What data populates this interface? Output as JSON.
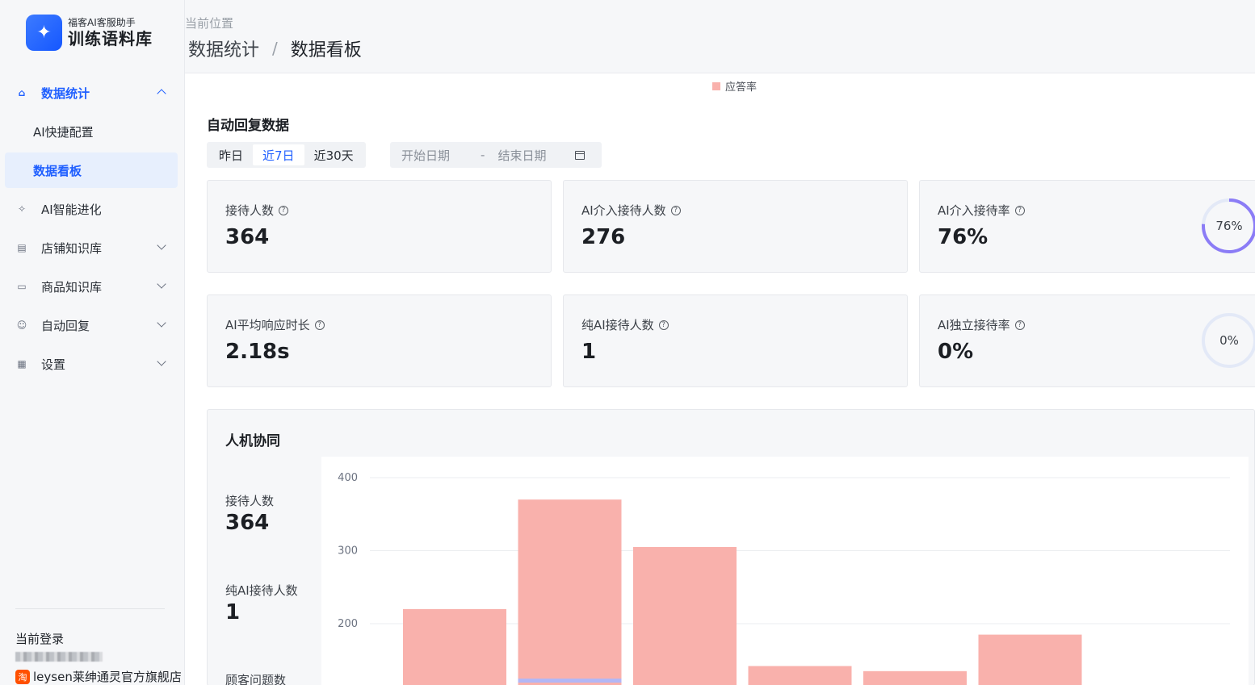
{
  "brand": {
    "subtitle": "福客AI客服助手",
    "title": "训练语料库",
    "logo_icon": "sparkle-icon"
  },
  "sidebar": {
    "items": [
      {
        "label": "数据统计",
        "icon": "home-icon",
        "expanded": true,
        "children": [
          {
            "label": "AI快捷配置"
          },
          {
            "label": "数据看板",
            "selected": true
          }
        ]
      },
      {
        "label": "AI智能进化",
        "icon": "sparkle-icon"
      },
      {
        "label": "店铺知识库",
        "icon": "book-icon"
      },
      {
        "label": "商品知识库",
        "icon": "box-icon"
      },
      {
        "label": "自动回复",
        "icon": "robot-icon"
      },
      {
        "label": "设置",
        "icon": "grid-icon"
      }
    ],
    "login_label": "当前登录",
    "shop_badge": "淘",
    "shop_name": "leysen莱绅通灵官方旗舰店"
  },
  "header": {
    "location_label": "当前位置",
    "breadcrumb": [
      "数据统计",
      "数据看板"
    ],
    "separator": "/"
  },
  "main": {
    "legend_top": "应答率",
    "section_title": "自动回复数据",
    "tabs": [
      "昨日",
      "近7日",
      "近30天"
    ],
    "active_tab": "近7日",
    "date_start_placeholder": "开始日期",
    "date_separator": "-",
    "date_end_placeholder": "结束日期",
    "help_glyph": "?",
    "cards": [
      {
        "label": "接待人数",
        "value": "364"
      },
      {
        "label": "AI介入接待人数",
        "value": "276"
      },
      {
        "label": "AI介入接待率",
        "value": "76%",
        "ring_text": "76%",
        "ring_fraction": 0.76
      },
      {
        "label": "AI平均响应时长",
        "value": "2.18s"
      },
      {
        "label": "纯AI接待人数",
        "value": "1"
      },
      {
        "label": "AI独立接待率",
        "value": "0%",
        "ring_text": "0%",
        "ring_fraction": 0
      }
    ],
    "collab": {
      "title": "人机协同",
      "stats": [
        {
          "label": "接待人数",
          "value": "364"
        },
        {
          "label": "纯AI接待人数",
          "value": "1"
        },
        {
          "label": "顾客问题数",
          "value": ""
        }
      ]
    }
  },
  "colors": {
    "accent": "#1f5fff",
    "bar": "#f9b1ac",
    "bar_secondary": "#b3b7f5",
    "ring": "#8b7cf6",
    "ring_track": "#e3e9f7"
  },
  "chart_data": {
    "type": "bar",
    "yticks": [
      200,
      300,
      400
    ],
    "ylim": [
      120,
      400
    ],
    "series": [
      {
        "values": [
          220,
          370,
          305,
          142,
          135,
          185
        ]
      },
      {
        "values": [
          0,
          3,
          0,
          0,
          0,
          0
        ]
      }
    ]
  }
}
